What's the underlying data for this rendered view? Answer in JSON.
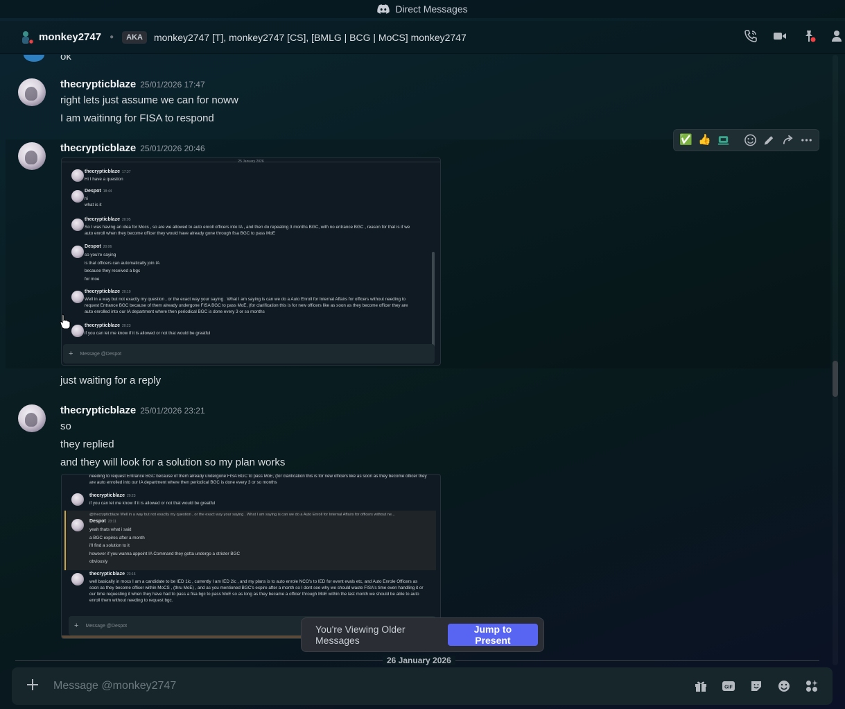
{
  "window": {
    "title": "Direct Messages"
  },
  "header": {
    "username": "monkey2747",
    "aka_label": "AKA",
    "aka_names": "monkey2747 [T], monkey2747 [CS], [BMLG | BCG | MoCS] monkey2747"
  },
  "partial_top_line": "ok",
  "messages": [
    {
      "author": "thecrypticblaze",
      "timestamp": "25/01/2026 17:47",
      "lines": [
        "right lets just assume we can for noww",
        "I am waitinng for FISA to respond"
      ]
    },
    {
      "author": "thecrypticblaze",
      "timestamp": "25/01/2026 20:46",
      "after_image": "just waiting for a reply"
    },
    {
      "author": "thecrypticblaze",
      "timestamp": "25/01/2026 23:21",
      "lines": [
        "so",
        "they replied",
        "and they will look for a solution so my plan works"
      ]
    }
  ],
  "reactions": {
    "check": "✅",
    "thumbs": "👍"
  },
  "screenshot1": {
    "date": "25 January 2026",
    "messages": [
      {
        "author": "thecrypticblaze",
        "time": "17:37",
        "text": "Hi I have a question"
      },
      {
        "author": "Despot",
        "time": "18:44",
        "text": "hi\nwhat is it"
      },
      {
        "author": "thecrypticblaze",
        "time": "20:05",
        "text": "So I was having an idea for Mocs , so are we allowed to auto enroll officers into IA , and then do repeating 3 months BGC, with no entrance BGC , reason for that is if we auto enroll when they become officer they would have already gone through fisa BGC to pass MoE"
      },
      {
        "author": "Despot",
        "time": "20:06",
        "text": "so you're saying\nis that officers can automatically join IA\nbecause they received a bgc\nfor moe"
      },
      {
        "author": "thecrypticblaze",
        "time": "20:10",
        "text": "Well in a way but not exactly my question , or the exact way your saying . What I am saying is can we do a Auto Enroll for Internal Affairs for officers without needing to request Entrance BGC because of them already undergone FISA BGC to pass MoE, (for clarification this is for new officers like as soon as they become officer they are auto enrolled into our IA department where then periodical BGC is done every 3 or so months"
      },
      {
        "author": "thecrypticblaze",
        "time": "20:23",
        "text": "if you can let me know if it is allowed or not that would be greatful"
      }
    ],
    "input_placeholder": "Message @Despot"
  },
  "screenshot2": {
    "top_text": "needing to request Entrance BGC because of them already undergone FISA BGC to pass MoE, (for clarification this is for new officers like as soon as they become officer they are auto enrolled into our IA department where then periodical BGC is done every 3 or so months",
    "messages": [
      {
        "author": "thecrypticblaze",
        "time": "20:23",
        "text": "if you can let me know if it is allowed or not that would be greatful"
      },
      {
        "reply": "@thecrypticblaze Well in a way but not exactly my question , or the exact way your saying . What I am saying is can we do a Auto Enroll for Internal Affairs for officers without ne...",
        "author": "Despot",
        "time": "23:11",
        "text": "yeah thats what i said\na BGC expires after a month\ni'll find a solution to it\nhowever if you wanna appoint IA Command they gotta undergo a stricter BGC\nobviously"
      },
      {
        "author": "thecrypticblaze",
        "time": "23:16",
        "text": "well basically in mocs I am a candidate to be IED 1ic , currently I am IED 2ic , and my plans is to auto enrole NCO's to IED for event evals etc, and Auto Enrole Officers as soon as they become officer within MoCS , (thru MoE) , and as you mentioned BGC's expire after a month so I dont see why we should waste FISA's time even handling it or our time requesting it when they have had to pass a fisa bgc to pass MoE so as long as they became a officer through MoE within the last month we should be  able to auto enroll them without needing to request bgc."
      }
    ],
    "input_placeholder": "Message @Despot"
  },
  "jump_bar": {
    "text": "You're Viewing Older Messages",
    "button": "Jump to Present"
  },
  "divider": {
    "label": "26 January 2026"
  },
  "composer": {
    "placeholder": "Message @monkey2747"
  },
  "colors": {
    "accent": "#5865f2",
    "background": "#0a1f24"
  }
}
